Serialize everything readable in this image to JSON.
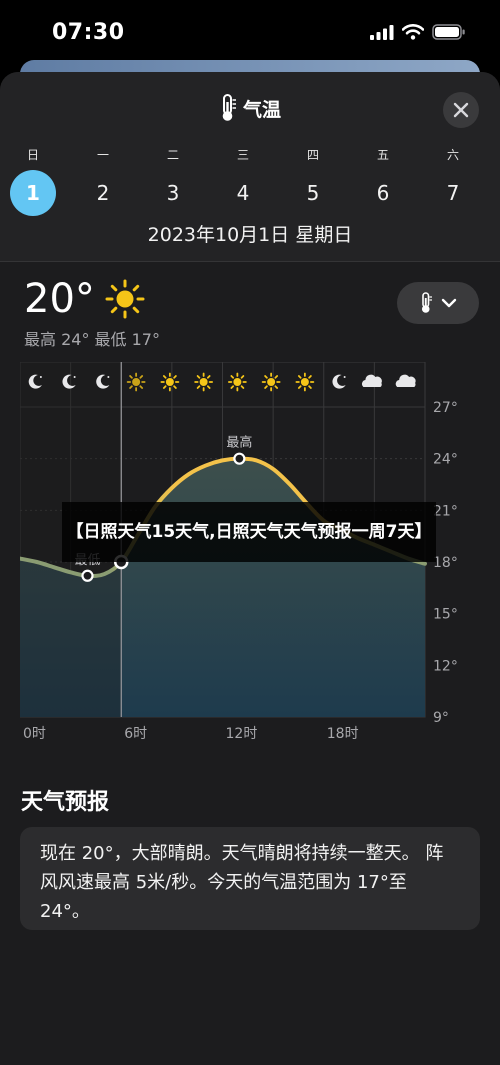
{
  "status": {
    "time": "07:30"
  },
  "sheet": {
    "title": "气温",
    "weekdays": [
      "日",
      "一",
      "二",
      "三",
      "四",
      "五",
      "六"
    ],
    "dates": [
      "1",
      "2",
      "3",
      "4",
      "5",
      "6",
      "7"
    ],
    "selected_date_index": 0,
    "full_date": "2023年10月1日 星期日"
  },
  "current": {
    "temperature": "20°",
    "range": "最高 24° 最低 17°",
    "condition_icon": "sun-icon"
  },
  "chart_data": {
    "type": "area",
    "x_tick_labels": [
      "0时",
      "6时",
      "12时",
      "18时"
    ],
    "y_tick_labels": [
      "27°",
      "24°",
      "21°",
      "18°",
      "15°",
      "12°",
      "9°"
    ],
    "x": [
      0,
      1,
      2,
      3,
      4,
      5,
      6,
      7,
      8,
      9,
      10,
      11,
      12,
      13,
      14,
      15,
      16,
      17,
      18,
      19,
      20,
      21,
      22,
      23,
      24
    ],
    "values": [
      18.2,
      18.0,
      17.7,
      17.4,
      17.2,
      17.3,
      18.0,
      19.6,
      21.2,
      22.3,
      23.1,
      23.6,
      23.9,
      24.0,
      23.9,
      23.4,
      22.5,
      21.4,
      20.4,
      19.9,
      19.4,
      19.0,
      18.6,
      18.2,
      17.9
    ],
    "ylim": [
      9,
      27
    ],
    "xlim": [
      0,
      24
    ],
    "annotations": [
      {
        "label": "最高",
        "x": 13,
        "y": 24
      },
      {
        "label": "最低",
        "x": 4,
        "y": 17.2
      }
    ],
    "current_hour": 6,
    "hourly_icons": [
      "moon-icon",
      "moon-icon",
      "moon-icon",
      "sun-icon",
      "sun-icon",
      "sun-icon",
      "sun-icon",
      "sun-icon",
      "sun-icon",
      "moon-icon",
      "cloud-icon",
      "cloud-icon"
    ],
    "colors": {
      "line_warm": "#f3c24a",
      "line_cool": "#8a9c72",
      "fill_top": "#3d4f4c",
      "fill_bottom": "#1e3b4d"
    }
  },
  "forecast": {
    "title": "天气预报",
    "text": "现在 20°，大部晴朗。天气晴朗将持续一整天。 阵风风速最高 5米/秒。今天的气温范围为 17°至 24°。"
  },
  "overlay": {
    "text": "【日照天气15天气,日照天气天气预报一周7天】"
  }
}
